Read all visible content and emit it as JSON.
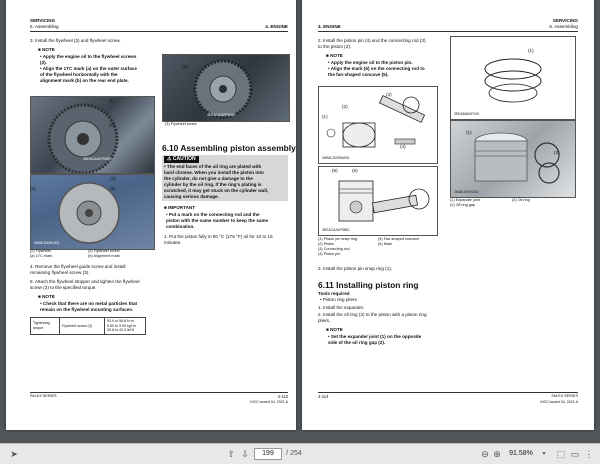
{
  "left": {
    "header_l1": "SERVICING",
    "header_l2": "6. Assembling",
    "header_r": "4. ENGINE",
    "step3": "3.  Install the flywheel (2) and flywheel screw.",
    "note": "NOTE",
    "note_b1": [
      "•  Apply the engine oil to the flywheel screws",
      "    (3).",
      "•  Align the 1TC mark (a) on the outer surface",
      "    of the flywheel horizontally with the",
      "    alignment mark (b) on the rear end plate."
    ],
    "photo_code_1": "3EEACAA1P015B",
    "callout_1": "(1)",
    "callout_2": "(2)",
    "callout_3": "(3)",
    "callout_a": "(a)",
    "callout_b": "(b)",
    "photo_code_2": "2MAEJ0009-002",
    "legend": [
      "(2)  Flywheel",
      "(3)  Flywheel screw",
      "(a)  1TC mark",
      "(b)  Alignment mark"
    ],
    "step4": [
      "4.  Remove the flywheel guide screw and install",
      "    remaining flywheel screw (3)."
    ],
    "step5": [
      "5.  Attach the flywheel stopper and tighten the flywheel",
      "    screw (3) to the specified torque."
    ],
    "note2": "NOTE",
    "note2_b1": [
      "•  Check that there are no metal particles that",
      "    remain on the flywheel mounting surfaces."
    ],
    "torque_label": "Tightening torque",
    "torque_item": "Flywheel screw (3)",
    "torque_values": [
      "53.9 to 58.8 N·m",
      "5.50 to 5.99 kgf·m",
      "39.8 to 43.3 lbf·ft"
    ],
    "photo_code_3": "3EEACAA1P016B",
    "callout_c3": "(3)",
    "caption_c3": "(3)  Flywheel screw",
    "section_title": "6.10 Assembling piston assembly",
    "caution": "CAUTION",
    "caution_lines": [
      "•  The end faces of the oil ring are plated with",
      "    hard chrome. When you install the piston into",
      "    the cylinder, do not give a damage to the",
      "    cylinder by the oil ring. If the ring's plating is",
      "    scratched, it may get stuck on the cylinder wall,",
      "    causing serious damage."
    ],
    "important": "IMPORTANT",
    "important_lines": [
      "•  Put a mark on the connecting rod and the",
      "    piston with the same number to keep the same",
      "    combination."
    ],
    "step1": [
      "1.  Put the piston fully in 80 °C (176 °F) oil for 10 to 15",
      "    minutes."
    ],
    "footer_l": "SM-E4 SERIES",
    "footer_r": "4-113",
    "footer_issue": "KiSC issued 04, 2021 A"
  },
  "right": {
    "header_l": "4. ENGINE",
    "header_r1": "SERVICING",
    "header_r2": "6. Assembling",
    "step2": [
      "2.  Install the piston pin (4) and the connecting rod (3)",
      "    to the piston (2)."
    ],
    "note": "NOTE",
    "note_lines": [
      "•  Apply the engine oil to the piston pin.",
      "•  Align the mark (6) on the connecting rod to",
      "    the fan-shaped concave (5)."
    ],
    "callout_1": "(1)",
    "callout_2": "(2)",
    "callout_3": "(3)",
    "callout_4": "(4)",
    "callout_5": "(5)",
    "callout_6": "(6)",
    "callout_r1": "(1)",
    "photo_code_a": "3WMCJ0009A001",
    "photo_code_b": "3EEACAA1P058C",
    "photo_code_c": "3EEABAB1P100",
    "photo_code_d": "2MAEJ0007A01",
    "legend": [
      "(1)  Piston pin snap ring",
      "(2)  Piston",
      "(3)  Connecting rod",
      "(4)  Piston pin",
      "(5)  Fan-shaped concave",
      "(6)  Mark"
    ],
    "callout_d1": "(1)",
    "callout_d2": "(2)",
    "legend2": [
      "(1)  Expander joint",
      "(2)  Oil ring gap",
      "(2)  Oil ring"
    ],
    "step3": "3.  Install the piston pin snap ring (1).",
    "section_title": "6.11 Installing piston ring",
    "tools": "Tools required",
    "tools_item": "•  Piston ring pliers",
    "step1": "1.  Install the expander.",
    "step2b": [
      "2.  Install the oil ring (3) to the piston with a piston ring",
      "    pliers."
    ],
    "note2": "NOTE",
    "note2_lines": [
      "•  Set the expander joint (1) on the opposite",
      "    side of the oil ring gap (2)."
    ],
    "footer_l": "4-114",
    "footer_r": "SM-E4 SERIES",
    "footer_issue": "KiSC issued 04, 2021 A"
  },
  "toolbar": {
    "page_current": "199",
    "page_total": "/ 254",
    "zoom": "91.58%"
  }
}
